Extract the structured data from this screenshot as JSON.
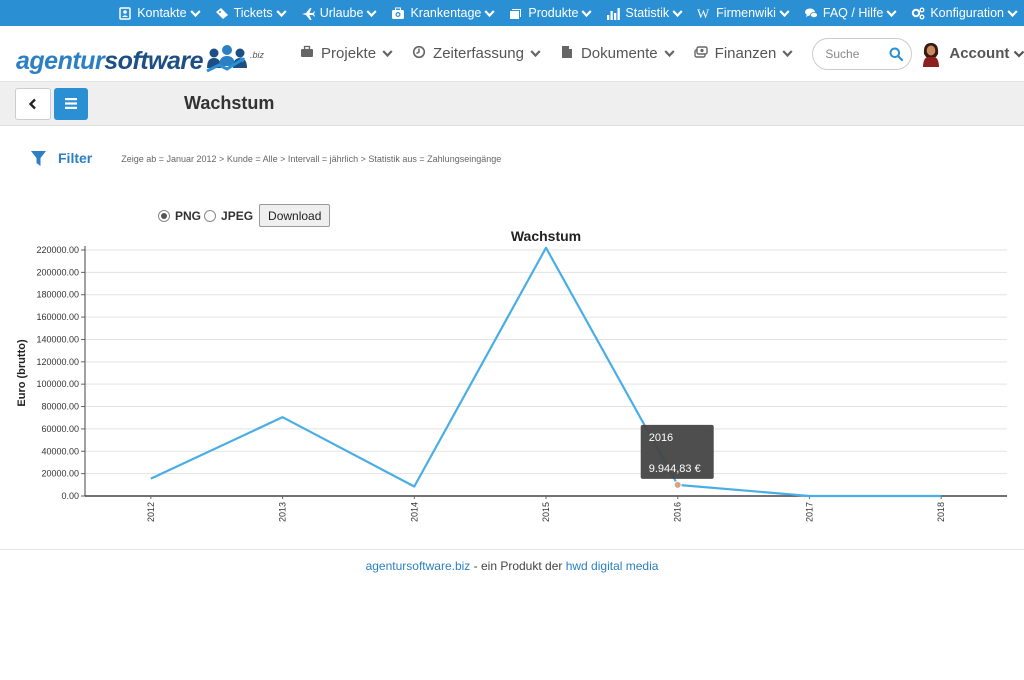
{
  "topnav": [
    {
      "label": "Kontakte",
      "icon": "contact-book-icon"
    },
    {
      "label": "Tickets",
      "icon": "ticket-icon"
    },
    {
      "label": "Urlaube",
      "icon": "airplane-icon"
    },
    {
      "label": "Krankentage",
      "icon": "medical-kit-icon"
    },
    {
      "label": "Produkte",
      "icon": "products-icon"
    },
    {
      "label": "Statistik",
      "icon": "bar-chart-icon"
    },
    {
      "label": "Firmenwiki",
      "icon": "wikipedia-icon"
    },
    {
      "label": "FAQ / Hilfe",
      "icon": "chat-bubbles-icon"
    },
    {
      "label": "Konfiguration",
      "icon": "gears-icon"
    }
  ],
  "logo": {
    "part1": "agentur",
    "part2": "software",
    "suffix": ".biz"
  },
  "mainnav": [
    {
      "label": "Projekte",
      "icon": "briefcase-icon"
    },
    {
      "label": "Zeiterfassung",
      "icon": "clock-icon"
    },
    {
      "label": "Dokumente",
      "icon": "document-icon"
    },
    {
      "label": "Finanzen",
      "icon": "money-icon"
    }
  ],
  "search": {
    "placeholder": "Suche"
  },
  "account": {
    "label": "Account"
  },
  "page": {
    "title": "Wachstum"
  },
  "filter": {
    "label": "Filter",
    "breadcrumb": "Zeige ab = Januar 2012 > Kunde = Alle > Intervall = jährlich > Statistik aus = Zahlungseingänge"
  },
  "export": {
    "png_label": "PNG",
    "jpeg_label": "JPEG",
    "selected": "PNG",
    "download_label": "Download"
  },
  "chart_data": {
    "type": "line",
    "title": "Wachstum",
    "xlabel": "",
    "ylabel": "Euro (brutto)",
    "categories": [
      "2012",
      "2013",
      "2014",
      "2015",
      "2016",
      "2017",
      "2018"
    ],
    "series": [
      {
        "values": [
          15500,
          70500,
          8500,
          222000,
          9944.83,
          0,
          0
        ]
      }
    ],
    "ylim": [
      0,
      220000
    ],
    "yticks": [
      "0.00",
      "20000.00",
      "40000.00",
      "60000.00",
      "80000.00",
      "100000.00",
      "120000.00",
      "140000.00",
      "160000.00",
      "180000.00",
      "200000.00",
      "220000.00"
    ],
    "grid": true,
    "line_color": "#4aaee6",
    "tooltip": {
      "label": "2016",
      "value": "9.944,83 €",
      "index": 4
    }
  },
  "footer": {
    "site": "agentursoftware.biz",
    "middle": " - ein Produkt der ",
    "company": "hwd digital media"
  },
  "colors": {
    "primary": "#2b8fd3",
    "link": "#2b7fc4"
  }
}
